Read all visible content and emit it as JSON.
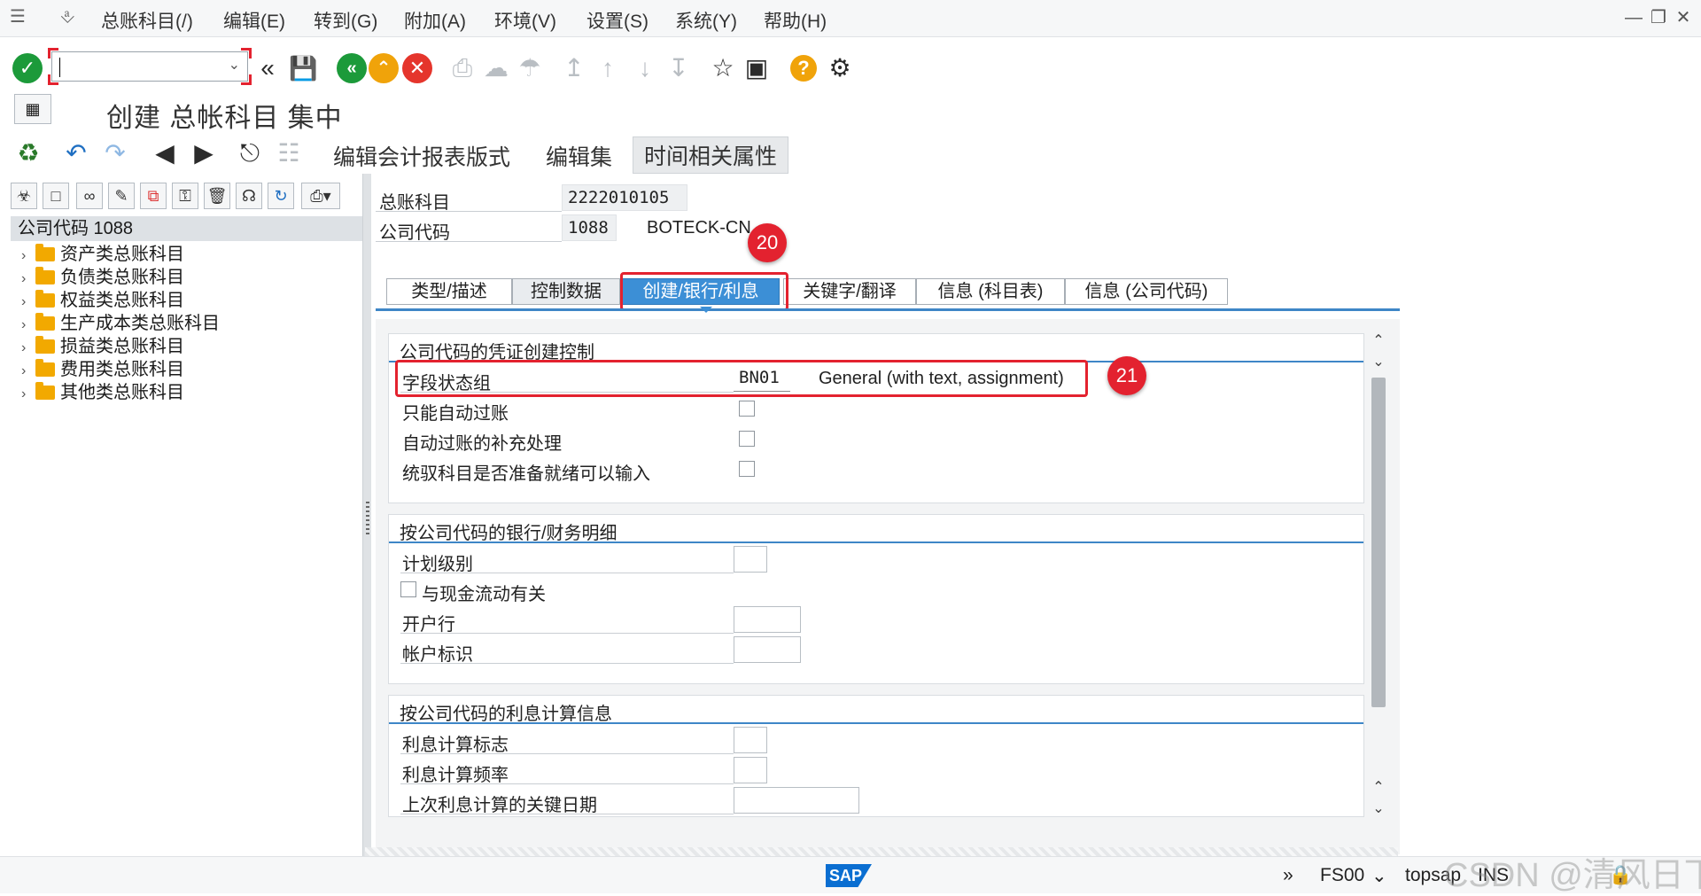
{
  "menu": {
    "items": [
      "总账科目(/)",
      "编辑(E)",
      "转到(G)",
      "附加(A)",
      "环境(V)",
      "设置(S)",
      "系统(Y)",
      "帮助(H)"
    ]
  },
  "toolbar": {
    "command_value": ""
  },
  "page": {
    "title": "创建 总帐科目 集中"
  },
  "app_toolbar": {
    "edit_layout": "编辑会计报表版式",
    "edit_set": "编辑集",
    "time_attrs": "时间相关属性"
  },
  "tree": {
    "root": "公司代码 1088",
    "items": [
      "资产类总账科目",
      "负债类总账科目",
      "权益类总账科目",
      "生产成本类总账科目",
      "损益类总账科目",
      "费用类总账科目",
      "其他类总账科目"
    ]
  },
  "header": {
    "gl_account_label": "总账科目",
    "gl_account_value": "2222010105",
    "company_code_label": "公司代码",
    "company_code_value": "1088",
    "company_name": "BOTECK-CN"
  },
  "tabs": [
    "类型/描述",
    "控制数据",
    "创建/银行/利息",
    "关键字/翻译",
    "信息 (科目表)",
    "信息 (公司代码)"
  ],
  "groups": {
    "doc_control": {
      "title": "公司代码的凭证创建控制",
      "field_status_label": "字段状态组",
      "field_status_value": "BN01",
      "field_status_desc": "General (with text, assignment)",
      "post_auto_only_label": "只能自动过账",
      "supplement_auto_label": "自动过账的补充处理",
      "recon_ready_label": "统驭科目是否准备就绪可以输入"
    },
    "bank_details": {
      "title": "按公司代码的银行/财务明细",
      "planning_level_label": "计划级别",
      "cash_flow_label": "与现金流动有关",
      "house_bank_label": "开户行",
      "account_id_label": "帐户标识"
    },
    "interest": {
      "title": "按公司代码的利息计算信息",
      "indicator_label": "利息计算标志",
      "frequency_label": "利息计算频率",
      "last_key_date_label": "上次利息计算的关键日期"
    }
  },
  "annotations": [
    "20",
    "21"
  ],
  "status": {
    "transaction": "FS00",
    "server": "topsap",
    "mode": "INS",
    "watermark": "CSDN @清风日下"
  },
  "colors": {
    "active_tab": "#3c8fd6",
    "annotation_red": "#e3222f",
    "ok_green": "#1c9a3a",
    "back_green": "#1c9a3a",
    "exit_orange": "#f0a30a",
    "cancel_red": "#e5352c",
    "help_orange": "#f0a30a"
  }
}
